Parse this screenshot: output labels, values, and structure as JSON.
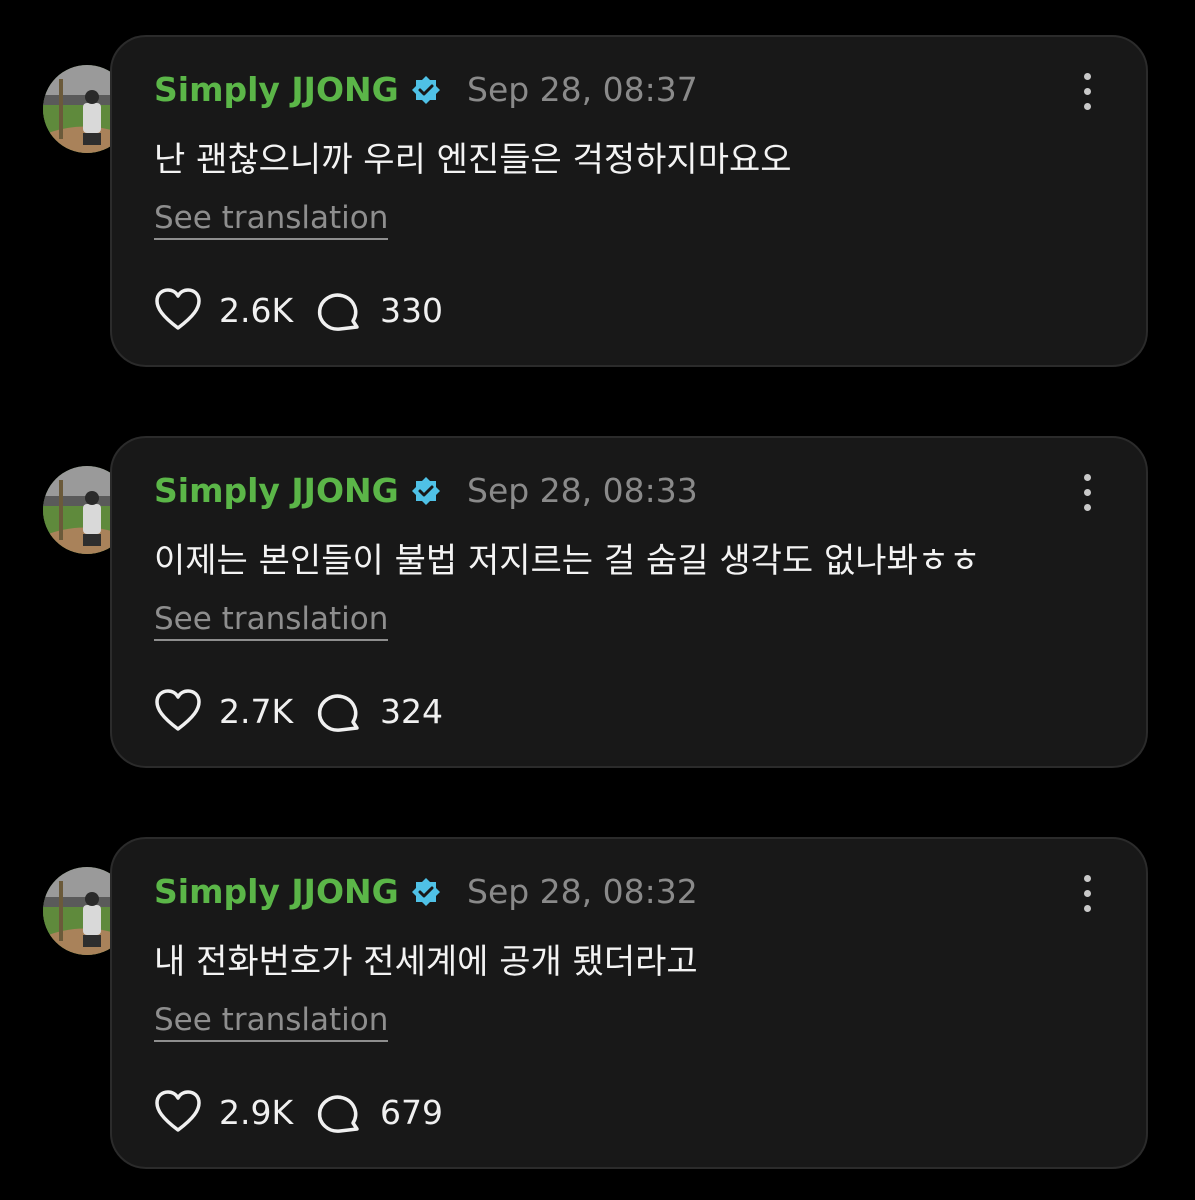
{
  "colors": {
    "author": "#5bb648",
    "verified": "#4fc1e6",
    "card_bg": "#181818",
    "background": "#000000"
  },
  "icons": {
    "avatar": "profile-photo",
    "verified": "verified-badge-icon",
    "more": "more-options-icon",
    "like": "heart-icon",
    "reply": "speech-bubble-icon"
  },
  "posts": [
    {
      "author": "Simply JJONG",
      "timestamp": "Sep 28, 08:37",
      "text": "난 괜찮으니까 우리 엔진들은 걱정하지마요오",
      "translate_label": "See translation",
      "likes": "2.6K",
      "replies": "330"
    },
    {
      "author": "Simply JJONG",
      "timestamp": "Sep 28, 08:33",
      "text": "이제는 본인들이 불법 저지르는 걸 숨길 생각도 없나봐ㅎㅎ",
      "translate_label": "See translation",
      "likes": "2.7K",
      "replies": "324"
    },
    {
      "author": "Simply JJONG",
      "timestamp": "Sep 28, 08:32",
      "text": "내 전화번호가 전세계에 공개 됐더라고",
      "translate_label": "See translation",
      "likes": "2.9K",
      "replies": "679"
    }
  ]
}
